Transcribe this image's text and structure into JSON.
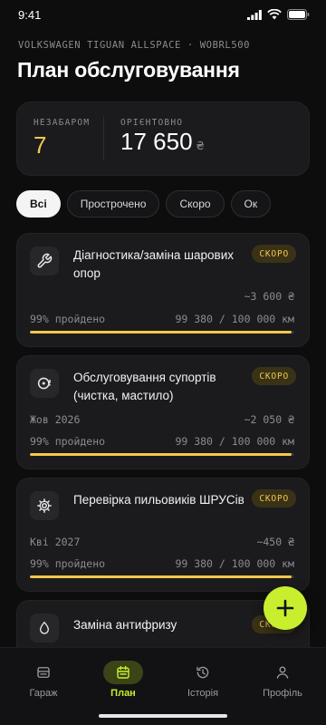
{
  "status": {
    "time": "9:41"
  },
  "header": {
    "vehicle": "VOLKSWAGEN TIGUAN ALLSPACE · WOBRL500",
    "title": "План обслуговування"
  },
  "summary": {
    "soon_label": "НЕЗАБАРОМ",
    "soon_count": "7",
    "approx_label": "ОРІЄНТОВНО",
    "approx_value": "17 650",
    "currency": "₴"
  },
  "filters": [
    "Всі",
    "Прострочено",
    "Скоро",
    "Ок"
  ],
  "active_filter": "Всі",
  "cards": [
    {
      "icon": "wrench-icon",
      "title": "Діагностика/заміна шарових опор",
      "badge": "СКОРО",
      "date": "",
      "cost": "~3 600 ₴",
      "passed": "99% пройдено",
      "mileage": "99 380 / 100 000 км",
      "progress": 0.99
    },
    {
      "icon": "brake-icon",
      "title": "Обслуговування супортів (чистка, мастило)",
      "badge": "СКОРО",
      "date": "Жов 2026",
      "cost": "~2 050 ₴",
      "passed": "99% пройдено",
      "mileage": "99 380 / 100 000 км",
      "progress": 0.99
    },
    {
      "icon": "gear-icon",
      "title": "Перевірка пильовиків ШРУСів",
      "badge": "СКОРО",
      "date": "Кві 2027",
      "cost": "~450 ₴",
      "passed": "99% пройдено",
      "mileage": "99 380 / 100 000 км",
      "progress": 0.99
    },
    {
      "icon": "drop-icon",
      "title": "Заміна антифризу",
      "badge": "СКОРО"
    }
  ],
  "nav": [
    {
      "label": "Гараж",
      "icon": "garage-icon",
      "active": false
    },
    {
      "label": "План",
      "icon": "calendar-icon",
      "active": true
    },
    {
      "label": "Історія",
      "icon": "history-icon",
      "active": false
    },
    {
      "label": "Профіль",
      "icon": "person-icon",
      "active": false
    }
  ],
  "colors": {
    "accent": "#c7ef2d",
    "warning": "#f2c94c",
    "background": "#0d0d0e",
    "card": "#1b1b1d"
  }
}
